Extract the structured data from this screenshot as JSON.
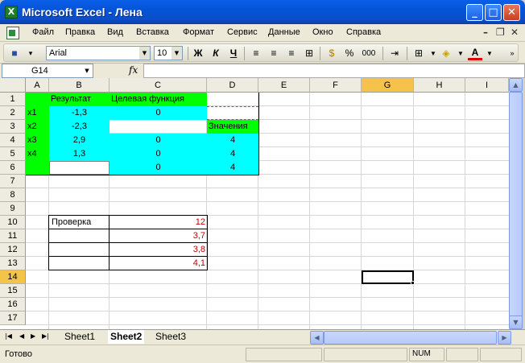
{
  "window": {
    "title": "Microsoft Excel - Лена",
    "icon": "excel-icon",
    "controls": {
      "minimize": "_",
      "maximize": "□",
      "close": "✕"
    }
  },
  "menu": {
    "items": [
      "Файл",
      "Правка",
      "Вид",
      "Вставка",
      "Формат",
      "Сервис",
      "Данные",
      "Окно",
      "Справка"
    ]
  },
  "toolbar": {
    "font_name": "Arial",
    "font_size": "10",
    "bold": "Ж",
    "italic": "К",
    "underline": "Ч",
    "percent": "%",
    "thousands": "000",
    "font_color_glyph": "A"
  },
  "formula_bar": {
    "name_box": "G14",
    "fx": "fx",
    "content": ""
  },
  "columns": [
    "A",
    "B",
    "C",
    "D",
    "E",
    "F",
    "G",
    "H",
    "I"
  ],
  "selected_column": "G",
  "rows": [
    "1",
    "2",
    "3",
    "4",
    "5",
    "6",
    "7",
    "8",
    "9",
    "10",
    "11",
    "12",
    "13",
    "14",
    "15",
    "16",
    "17"
  ],
  "selected_row": "14",
  "cells": {
    "B1": "Результат",
    "C1": "Целевая функция",
    "A2": "x1",
    "B2": "-1,3",
    "C2": "0",
    "A3": "x2",
    "B3": "-2,3",
    "D3": "Значения",
    "A4": "x3",
    "B4": "2,9",
    "C4": "0",
    "D4": "4",
    "A5": "x4",
    "B5": "1,3",
    "C5": "0",
    "D5": "4",
    "C6": "0",
    "D6": "4",
    "B10": "Проверка",
    "C10": "12",
    "C11": "3,7",
    "C12": "3,8",
    "C13": "4,1"
  },
  "colors": {
    "cyan_fill": "#00ffff",
    "green_fill": "#00ff00",
    "check_values": "#c00000",
    "selection_header": "#f5c24a"
  },
  "sheets": {
    "tabs": [
      "Sheet1",
      "Sheet2",
      "Sheet3"
    ],
    "active": "Sheet2"
  },
  "status": {
    "text": "Готово",
    "num": "NUM"
  }
}
